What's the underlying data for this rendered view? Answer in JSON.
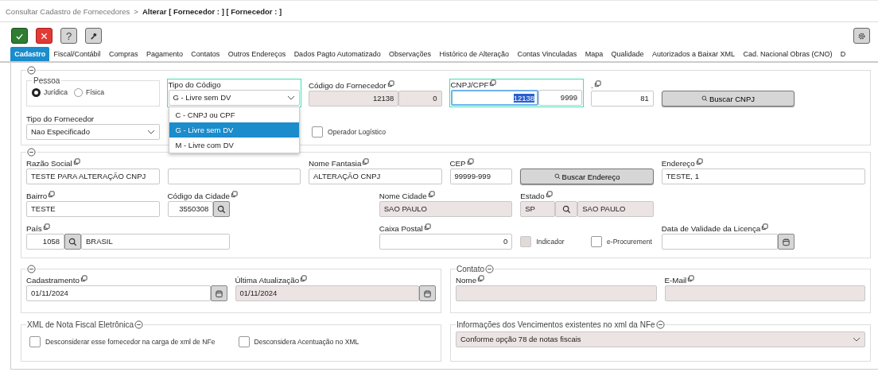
{
  "breadcrumb": {
    "parent": "Consultar Cadastro de Fornecedores",
    "separator": ">",
    "current": "Alterar [ Fornecedor : ] [ Fornecedor : ]"
  },
  "toolbar": [
    {
      "kind": "confirm"
    },
    {
      "kind": "cancel"
    },
    {
      "kind": "help",
      "label": "?"
    },
    {
      "kind": "tools"
    }
  ],
  "tabs": [
    {
      "label": "Cadastro",
      "selected": true
    },
    {
      "label": "Fiscal/Contábil",
      "selected": false
    },
    {
      "label": "Compras",
      "selected": false
    },
    {
      "label": "Pagamento",
      "selected": false
    },
    {
      "label": "Contatos",
      "selected": false
    },
    {
      "label": "Outros Endereços",
      "selected": false
    },
    {
      "label": "Dados Pagto Automatizado",
      "selected": false
    },
    {
      "label": "Observações",
      "selected": false
    },
    {
      "label": "Histórico de Alteração",
      "selected": false
    },
    {
      "label": "Contas Vinculadas",
      "selected": false
    },
    {
      "label": "Mapa",
      "selected": false
    },
    {
      "label": "Qualidade",
      "selected": false
    },
    {
      "label": "Autorizados a Baixar XML",
      "selected": false
    },
    {
      "label": "Cad. Nacional Obras (CNO)",
      "selected": false
    },
    {
      "label": "D",
      "selected": false
    }
  ],
  "identificacao": {
    "pessoa": {
      "legend": "Pessoa",
      "options": [
        {
          "label": "Jurídica",
          "selected": true
        },
        {
          "label": "Física",
          "selected": false
        }
      ]
    },
    "tipo_codigo": {
      "label": "Tipo do Código",
      "value": "G - Livre sem DV",
      "expanded": true,
      "options": [
        {
          "label": "C - CNPJ ou CPF",
          "selected": false
        },
        {
          "label": "G - Livre sem DV",
          "selected": true
        },
        {
          "label": "M - Livre com DV",
          "selected": false
        }
      ]
    },
    "codigo_fornecedor": {
      "label": "Código do Fornecedor",
      "copy": true,
      "values": [
        "12138",
        "0"
      ]
    },
    "cnpj_cpf": {
      "label": "CNPJ/CPF",
      "copy": true,
      "values": [
        "12138",
        "9999"
      ]
    },
    "digito": {
      "label": ".",
      "copy": true,
      "value": "81"
    },
    "buscar_cnpj": "Buscar CNPJ",
    "tipo_fornecedor": {
      "label": "Tipo do Fornecedor",
      "value": "Nao Especificado"
    },
    "operador_logistico": {
      "label": "Operador Logístico",
      "checked": false
    }
  },
  "endereco": [
    {
      "kind": "text",
      "label": "Razão Social",
      "copy": true,
      "value": "TESTE PARA ALTERAÇÃO CNPJ"
    },
    {
      "kind": "text"
    },
    {
      "kind": "text",
      "label": "Nome Fantasia",
      "copy": true,
      "value": "ALTERAÇÃO CNPJ"
    },
    {
      "kind": "text",
      "label": "CEP",
      "copy": true,
      "value": "99999-999"
    },
    {
      "kind": "button",
      "label": "Buscar Endereço"
    },
    {
      "kind": "text",
      "label": "Endereço",
      "copy": true,
      "value": "TESTE, 1"
    },
    {
      "kind": "text",
      "label": "Bairro",
      "copy": true,
      "value": "TESTE"
    },
    {
      "kind": "lookup",
      "label": "Código da Cidade",
      "copy": true,
      "value": "3550308"
    },
    {
      "kind": "text",
      "label": "Nome Cidade",
      "copy": true,
      "value": "SAO PAULO",
      "disabled": true
    },
    {
      "kind": "lookup_pair",
      "label": "Estado",
      "copy": true,
      "code": "SP",
      "value": "SAO PAULO",
      "disabled": true
    },
    {
      "kind": "lookup_pair",
      "label": "País",
      "copy": true,
      "code": "1058",
      "value": "BRASIL",
      "disabled": false
    },
    {
      "kind": "number",
      "label": "Caixa Postal",
      "copy": true,
      "value": "0"
    },
    {
      "kind": "checkbox",
      "label": "Indicador",
      "checked": false,
      "disabled": true
    },
    {
      "kind": "checkbox",
      "label": "e-Procurement",
      "checked": false,
      "disabled": false
    },
    {
      "kind": "date",
      "label": "Data de Validade da Licença",
      "copy": true
    }
  ],
  "datas": [
    {
      "label": "Cadastramento",
      "copy": true,
      "value": "01/11/2024",
      "disabled": false
    },
    {
      "label": "Última Atualização",
      "copy": true,
      "value": "01/11/2024",
      "disabled": true
    }
  ],
  "contato": {
    "legend": "Contato",
    "fields": [
      {
        "label": "Nome",
        "copy": true,
        "disabled": true
      },
      {
        "label": "E-Mail",
        "copy": true,
        "disabled": true
      }
    ]
  },
  "xml_nfe": {
    "legend": "XML de Nota Fiscal Eletrônica",
    "options": [
      {
        "label": "Desconsiderar esse fornecedor na carga de xml de NFe",
        "checked": false
      },
      {
        "label": "Desconsidera Acentuação no XML",
        "checked": false
      }
    ]
  },
  "vencimentos": {
    "legend": "Informações dos Vencimentos existentes no xml da NFe",
    "value": "Conforme opção 78 de notas fiscais",
    "disabled": true
  }
}
